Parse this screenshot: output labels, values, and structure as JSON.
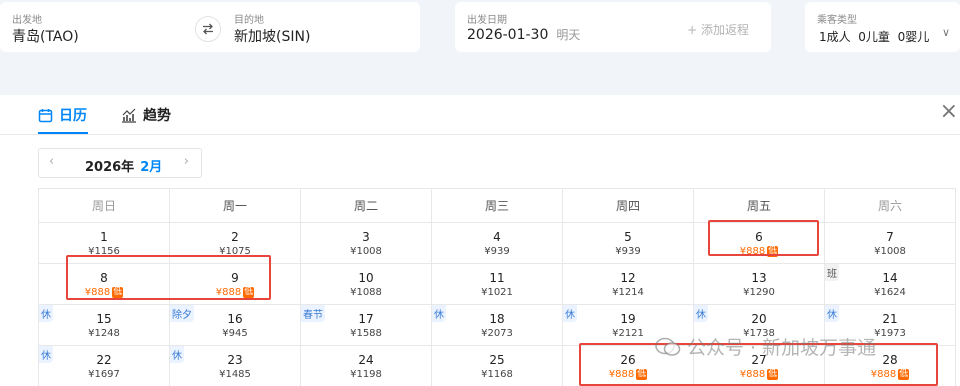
{
  "search": {
    "origin": {
      "label": "出发地",
      "value": "青岛(TAO)"
    },
    "destination": {
      "label": "目的地",
      "value": "新加坡(SIN)"
    },
    "swap_icon": "swap-arrows-icon",
    "depart": {
      "label": "出发日期",
      "value": "2026-01-30",
      "extra": "明天",
      "return_hint": "+ 添加返程"
    },
    "passengers": {
      "label": "乘客类型",
      "adult": "1成人",
      "child": "0儿童",
      "infant": "0婴儿"
    }
  },
  "panel": {
    "tabs": [
      {
        "label": "日历",
        "icon": "calendar-icon",
        "active": true
      },
      {
        "label": "趋势",
        "icon": "trend-chart-icon",
        "active": false
      }
    ],
    "close": "×",
    "month_nav": {
      "year": "2026年",
      "month": "2月",
      "prev": "‹",
      "next": "›"
    },
    "weekdays": [
      "周日",
      "周一",
      "周二",
      "周三",
      "周四",
      "周五",
      "周六"
    ],
    "weeks": [
      [
        {
          "day": "1",
          "price": "¥1156"
        },
        {
          "day": "2",
          "price": "¥1075"
        },
        {
          "day": "3",
          "price": "¥1008"
        },
        {
          "day": "4",
          "price": "¥939"
        },
        {
          "day": "5",
          "price": "¥939"
        },
        {
          "day": "6",
          "price": "¥888",
          "low": "低"
        },
        {
          "day": "7",
          "price": "¥1008"
        }
      ],
      [
        {
          "day": "8",
          "price": "¥888",
          "low": "低"
        },
        {
          "day": "9",
          "price": "¥888",
          "low": "低"
        },
        {
          "day": "10",
          "price": "¥1088"
        },
        {
          "day": "11",
          "price": "¥1021"
        },
        {
          "day": "12",
          "price": "¥1214"
        },
        {
          "day": "13",
          "price": "¥1290"
        },
        {
          "day": "14",
          "price": "¥1624",
          "tag": "班"
        }
      ],
      [
        {
          "day": "15",
          "price": "¥1248",
          "tag": "休"
        },
        {
          "day": "16",
          "price": "¥945",
          "tag": "除夕"
        },
        {
          "day": "17",
          "price": "¥1588",
          "tag": "春节"
        },
        {
          "day": "18",
          "price": "¥2073",
          "tag": "休"
        },
        {
          "day": "19",
          "price": "¥2121",
          "tag": "休"
        },
        {
          "day": "20",
          "price": "¥1738",
          "tag": "休"
        },
        {
          "day": "21",
          "price": "¥1973",
          "tag": "休"
        }
      ],
      [
        {
          "day": "22",
          "price": "¥1697",
          "tag": "休"
        },
        {
          "day": "23",
          "price": "¥1485",
          "tag": "休"
        },
        {
          "day": "24",
          "price": "¥1198"
        },
        {
          "day": "25",
          "price": "¥1168"
        },
        {
          "day": "26",
          "price": "¥888",
          "low": "低"
        },
        {
          "day": "27",
          "price": "¥888",
          "low": "低"
        },
        {
          "day": "28",
          "price": "¥888",
          "low": "低"
        }
      ]
    ]
  },
  "highlight_color": "#e8453c",
  "low_price_color": "#ff6a00",
  "accent_color": "#0086f6",
  "watermark": "公众号 · 新加坡万事通"
}
